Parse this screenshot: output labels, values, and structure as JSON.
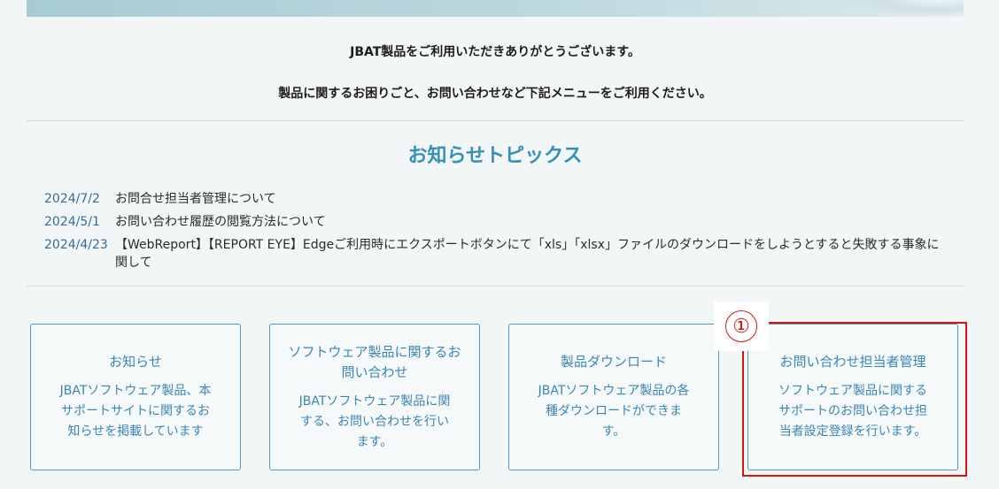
{
  "welcome": {
    "line1": "JBAT製品をご利用いただきありがとうございます。",
    "line2": "製品に関するお困りごと、お問い合わせなど下記メニューをご利用ください。"
  },
  "topics": {
    "title": "お知らせトピックス",
    "items": [
      {
        "date": "2024/7/2",
        "title": "お問合せ担当者管理について"
      },
      {
        "date": "2024/5/1",
        "title": "お問い合わせ履歴の閲覧方法について"
      },
      {
        "date": "2024/4/23",
        "title": "【WebReport】【REPORT EYE】Edgeご利用時にエクスポートボタンにて「xls」「xlsx」ファイルのダウンロードをしようとすると失敗する事象に関して"
      }
    ]
  },
  "cards": [
    {
      "title": "お知らせ",
      "desc": "JBATソフトウェア製品、本サポートサイトに関するお知らせを掲載しています"
    },
    {
      "title": "ソフトウェア製品に関するお問い合わせ",
      "desc": "JBATソフトウェア製品に関する、お問い合わせを行います。"
    },
    {
      "title": "製品ダウンロード",
      "desc": "JBATソフトウェア製品の各種ダウンロードができます。"
    },
    {
      "title": "お問い合わせ担当者管理",
      "desc": "ソフトウェア製品に関するサポートのお問い合わせ担当者設定登録を行います。"
    }
  ],
  "annotation": {
    "marker": "①",
    "color": "#d9140f"
  },
  "colors": {
    "accent": "#3591b5",
    "card_text": "#3a86b2",
    "card_border": "#4e9bbd"
  }
}
